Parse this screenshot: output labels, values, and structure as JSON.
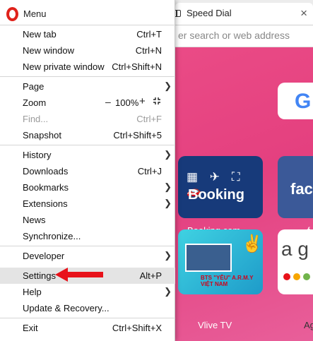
{
  "menu": {
    "title": "Menu",
    "groups": [
      [
        {
          "label": "New tab",
          "shortcut": "Ctrl+T"
        },
        {
          "label": "New window",
          "shortcut": "Ctrl+N"
        },
        {
          "label": "New private window",
          "shortcut": "Ctrl+Shift+N"
        }
      ],
      [
        {
          "label": "Page",
          "submenu": true
        },
        {
          "label": "Zoom",
          "zoom_value": "100%",
          "zoom_minus": "–",
          "zoom_plus": "+"
        },
        {
          "label": "Find...",
          "shortcut": "Ctrl+F",
          "disabled": true
        },
        {
          "label": "Snapshot",
          "shortcut": "Ctrl+Shift+5"
        }
      ],
      [
        {
          "label": "History",
          "submenu": true
        },
        {
          "label": "Downloads",
          "shortcut": "Ctrl+J"
        },
        {
          "label": "Bookmarks",
          "submenu": true
        },
        {
          "label": "Extensions",
          "submenu": true
        },
        {
          "label": "News"
        },
        {
          "label": "Synchronize..."
        }
      ],
      [
        {
          "label": "Developer",
          "submenu": true
        },
        {
          "label": "Settings",
          "shortcut": "Alt+P",
          "highlighted": true
        },
        {
          "label": "Help",
          "submenu": true
        },
        {
          "label": "Update & Recovery..."
        }
      ],
      [
        {
          "label": "Exit",
          "shortcut": "Ctrl+Shift+X"
        }
      ]
    ]
  },
  "browser": {
    "tab_title": "Speed Dial",
    "tab_close": "×",
    "address_placeholder": "er search or web address",
    "tiles": {
      "google_letter": "G",
      "booking_icons": "▦ ✈ ⛶ 🚗",
      "booking_word": "Booking",
      "booking_label": "Booking.com",
      "facebook_word": "fac",
      "facebook_label": "f",
      "vlive_mark": "✌",
      "vlive_text": "BTS \"YÊU\" A.R.M.Y VIỆT NAM",
      "vlive_label": "Vlive TV",
      "ago_letter": "a g",
      "ago_label": "Ag"
    }
  },
  "colors": {
    "opera_red": "#e0221b",
    "speed_dial_bg": "#e4407f",
    "arrow_red": "#e8121a",
    "highlight": "#e4e4e4"
  }
}
